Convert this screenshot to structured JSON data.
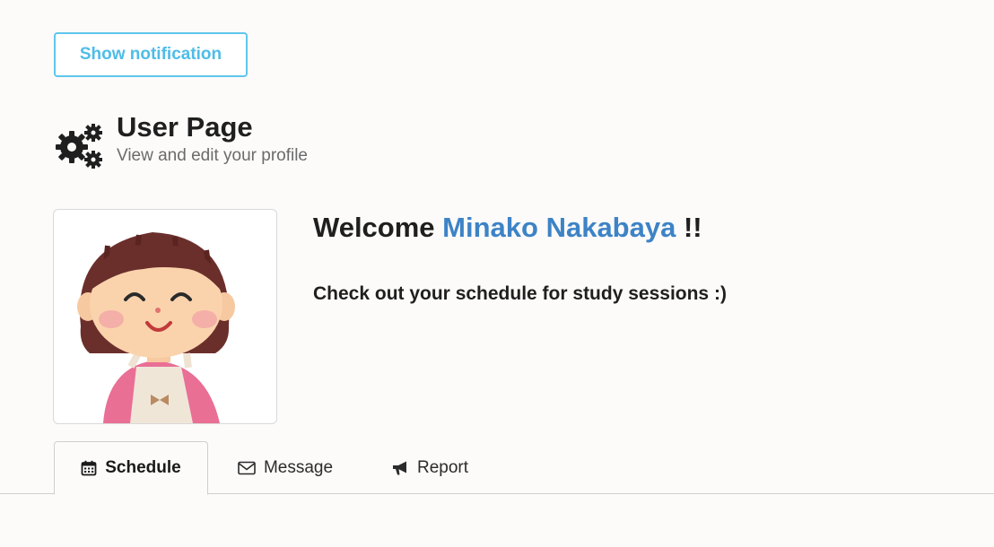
{
  "notification_button": {
    "label": "Show notification"
  },
  "header": {
    "icon": "gears-icon",
    "title": "User Page",
    "subtitle": "View and edit your profile"
  },
  "profile": {
    "avatar_icon": "user-avatar-illustration",
    "welcome_prefix": "Welcome",
    "user_name": "Minako Nakabaya",
    "welcome_suffix": "!!",
    "tagline": "Check out your schedule for study sessions :)"
  },
  "tabs": [
    {
      "label": "Schedule",
      "icon": "calendar-icon",
      "active": true
    },
    {
      "label": "Message",
      "icon": "envelope-icon",
      "active": false
    },
    {
      "label": "Report",
      "icon": "bullhorn-icon",
      "active": false
    }
  ],
  "colors": {
    "accent": "#5fc6ee",
    "name_link": "#3d83c6",
    "background": "#fcfbfa"
  }
}
